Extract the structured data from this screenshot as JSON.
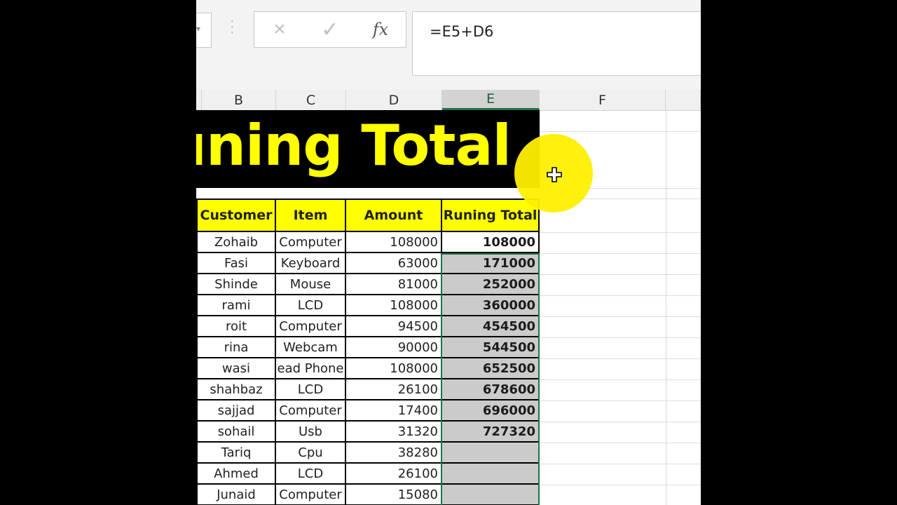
{
  "formula_bar": {
    "cancel_icon": "×",
    "enter_icon": "✓",
    "fx_label": "fx",
    "formula": "=E5+D6"
  },
  "columns": [
    "B",
    "C",
    "D",
    "E",
    "F"
  ],
  "selected_column": "E",
  "banner": {
    "title": "uning Total"
  },
  "table": {
    "headers": [
      "Customer",
      "Item",
      "Amount",
      "Runing Total"
    ],
    "rows": [
      [
        "Zohaib",
        "Computer",
        "108000",
        "108000"
      ],
      [
        "Fasi",
        "Keyboard",
        "63000",
        "171000"
      ],
      [
        "Shinde",
        "Mouse",
        "81000",
        "252000"
      ],
      [
        "rami",
        "LCD",
        "108000",
        "360000"
      ],
      [
        "roit",
        "Computer",
        "94500",
        "454500"
      ],
      [
        "rina",
        "Webcam",
        "90000",
        "544500"
      ],
      [
        "wasi",
        "ead Phone",
        "108000",
        "652500"
      ],
      [
        "shahbaz",
        "LCD",
        "26100",
        "678600"
      ],
      [
        "sajjad",
        "Computer",
        "17400",
        "696000"
      ],
      [
        "sohail",
        "Usb",
        "31320",
        "727320"
      ],
      [
        "Tariq",
        "Cpu",
        "38280",
        ""
      ],
      [
        "Ahmed",
        "LCD",
        "26100",
        ""
      ],
      [
        "Junaid",
        "Computer",
        "15080",
        ""
      ]
    ]
  },
  "colors": {
    "header_fill": "#ffff00",
    "banner_text": "#ffff00",
    "selection": "#217346"
  },
  "cursor_icon": "fill-cross-cursor-icon"
}
